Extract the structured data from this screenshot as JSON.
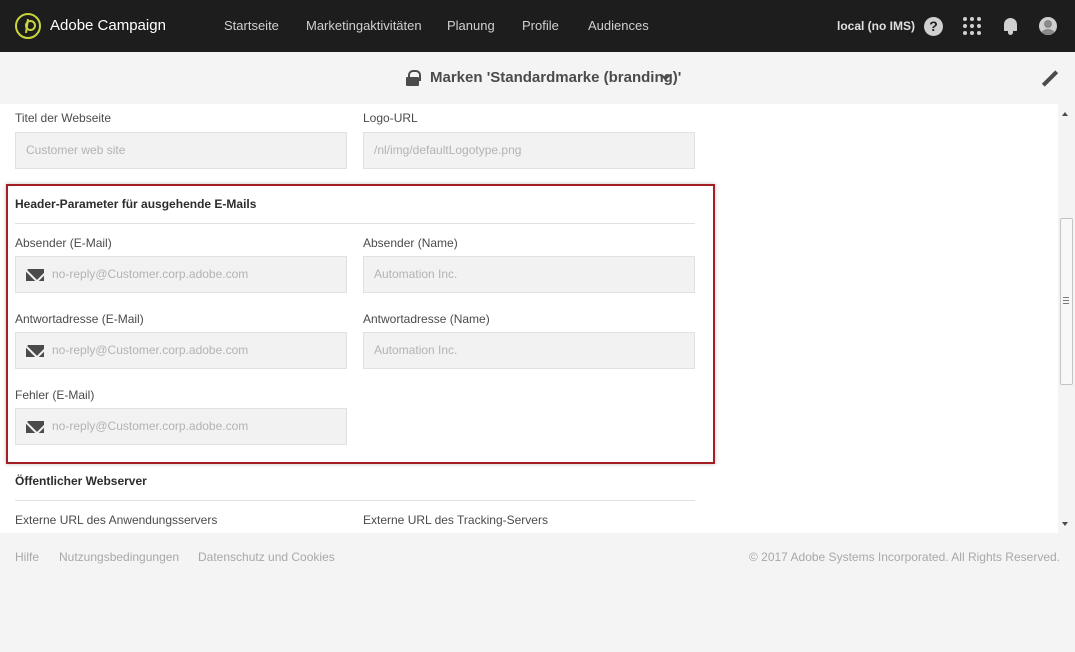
{
  "topnav": {
    "app_title": "Adobe Campaign",
    "items": [
      "Startseite",
      "Marketingaktivitäten",
      "Planung",
      "Profile",
      "Audiences"
    ],
    "env_label": "local (no IMS)",
    "help_glyph": "?",
    "icons": [
      "adobe-campaign-logo-icon",
      "help-icon",
      "apps-grid-icon",
      "bell-icon",
      "avatar-icon"
    ],
    "logo_color": "#c9d53b"
  },
  "header": {
    "title": "Marken 'Standardmarke (branding)'",
    "icons": [
      "lock-icon",
      "chevron-down-icon",
      "edit-pencil-icon"
    ]
  },
  "form": {
    "website_title": {
      "label": "Titel der Webseite",
      "value": "Customer web site"
    },
    "logo_url": {
      "label": "Logo-URL",
      "value": "/nl/img/defaultLogotype.png"
    },
    "email_headers": {
      "title": "Header-Parameter für ausgehende E-Mails",
      "sender_email": {
        "label": "Absender (E-Mail)",
        "value": "no-reply@Customer.corp.adobe.com"
      },
      "sender_name": {
        "label": "Absender (Name)",
        "value": "Automation Inc."
      },
      "reply_email": {
        "label": "Antwortadresse (E-Mail)",
        "value": "no-reply@Customer.corp.adobe.com"
      },
      "reply_name": {
        "label": "Antwortadresse (Name)",
        "value": "Automation Inc."
      },
      "error_email": {
        "label": "Fehler (E-Mail)",
        "value": "no-reply@Customer.corp.adobe.com"
      }
    },
    "public_webserver": {
      "title": "Öffentlicher Webserver",
      "app_server_url_label": "Externe URL des Anwendungsservers",
      "tracking_server_url_label": "Externe URL des Tracking-Servers"
    }
  },
  "highlight_color": "#a31f24",
  "footer": {
    "links": [
      "Hilfe",
      "Nutzungsbedingungen",
      "Datenschutz und Cookies"
    ],
    "copyright": "© 2017 Adobe Systems Incorporated. All Rights Reserved."
  }
}
